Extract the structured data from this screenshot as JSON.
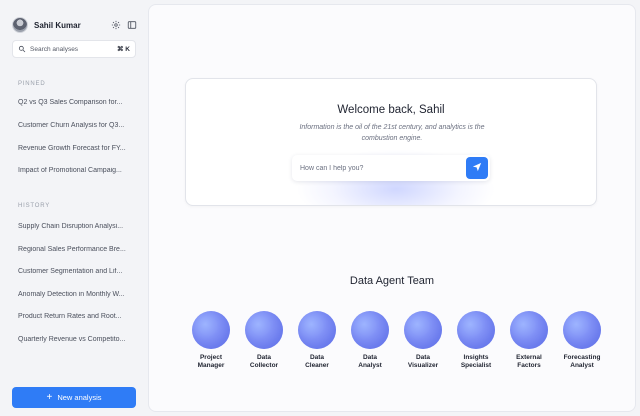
{
  "user": {
    "name": "Sahil Kumar"
  },
  "search": {
    "placeholder": "Search analyses",
    "shortcut": "⌘ K"
  },
  "pinned": {
    "label": "PINNED",
    "items": [
      "Q2 vs Q3 Sales Comparison for...",
      "Customer Churn Analysis for Q3...",
      "Revenue Growth Forecast for FY...",
      "Impact of Promotional Campaig..."
    ]
  },
  "history": {
    "label": "HISTORY",
    "items": [
      "Supply Chain Disruption Analysi...",
      "Regional Sales Performance Bre...",
      "Customer Segmentation and Lif...",
      "Anomaly Detection in Monthly W...",
      "Product Return Rates and Root...",
      "Quarterly Revenue vs Competito..."
    ]
  },
  "new_analysis_label": "New analysis",
  "welcome": {
    "title": "Welcome back, Sahil",
    "subtitle": "Information is the oil of the 21st century, and analytics is the combustion engine.",
    "prompt_placeholder": "How can I help you?"
  },
  "team": {
    "title": "Data Agent Team",
    "agents": [
      {
        "line1": "Project",
        "line2": "Manager"
      },
      {
        "line1": "Data",
        "line2": "Collector"
      },
      {
        "line1": "Data",
        "line2": "Cleaner"
      },
      {
        "line1": "Data",
        "line2": "Analyst"
      },
      {
        "line1": "Data",
        "line2": "Visualizer"
      },
      {
        "line1": "Insights",
        "line2": "Specialist"
      },
      {
        "line1": "External",
        "line2": "Factors"
      },
      {
        "line1": "Forecasting",
        "line2": "Analyst"
      }
    ]
  },
  "colors": {
    "accent": "#2f7cf6",
    "orb": "#7f8ff5"
  }
}
